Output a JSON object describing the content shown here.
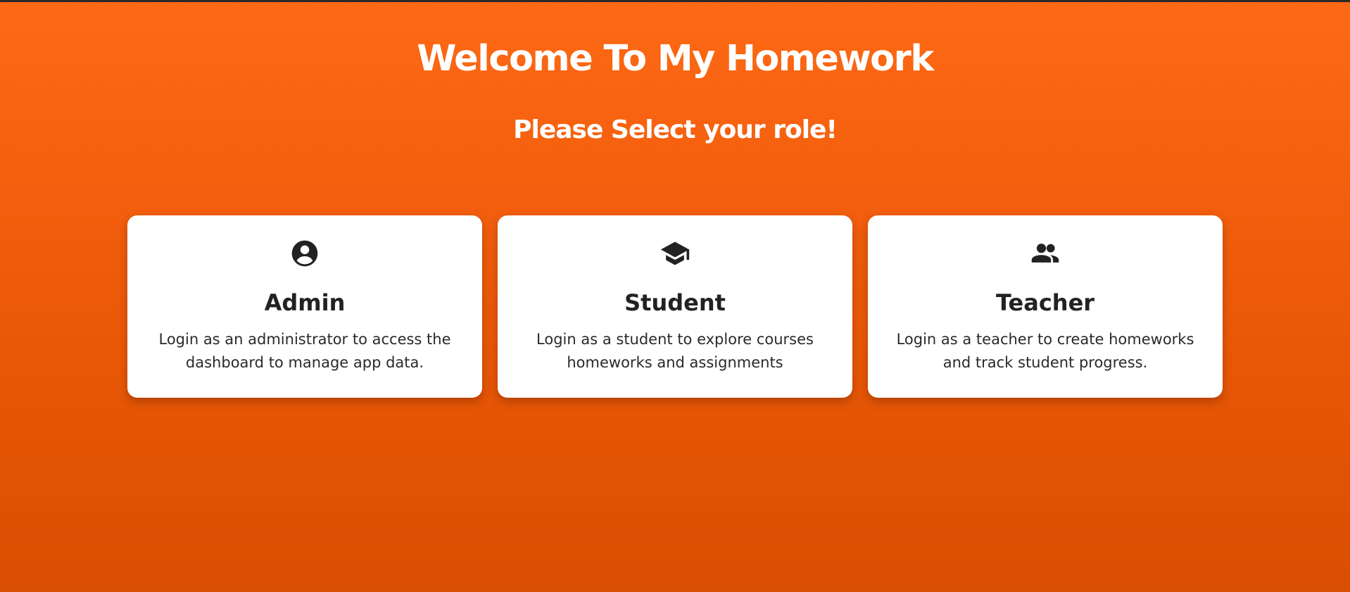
{
  "header": {
    "title": "Welcome To My Homework",
    "subtitle": "Please Select your role!"
  },
  "roles": [
    {
      "icon": "account-circle-icon",
      "name": "Admin",
      "description": "Login as an administrator to access the dashboard to manage app data."
    },
    {
      "icon": "graduation-cap-icon",
      "name": "Student",
      "description": "Login as a student to explore courses homeworks and assignments"
    },
    {
      "icon": "people-icon",
      "name": "Teacher",
      "description": "Login as a teacher to create homeworks and track student progress."
    }
  ],
  "colors": {
    "background_top": "#fd6914",
    "background_bottom": "#da4e02",
    "card": "#ffffff",
    "icon": "#222222"
  }
}
